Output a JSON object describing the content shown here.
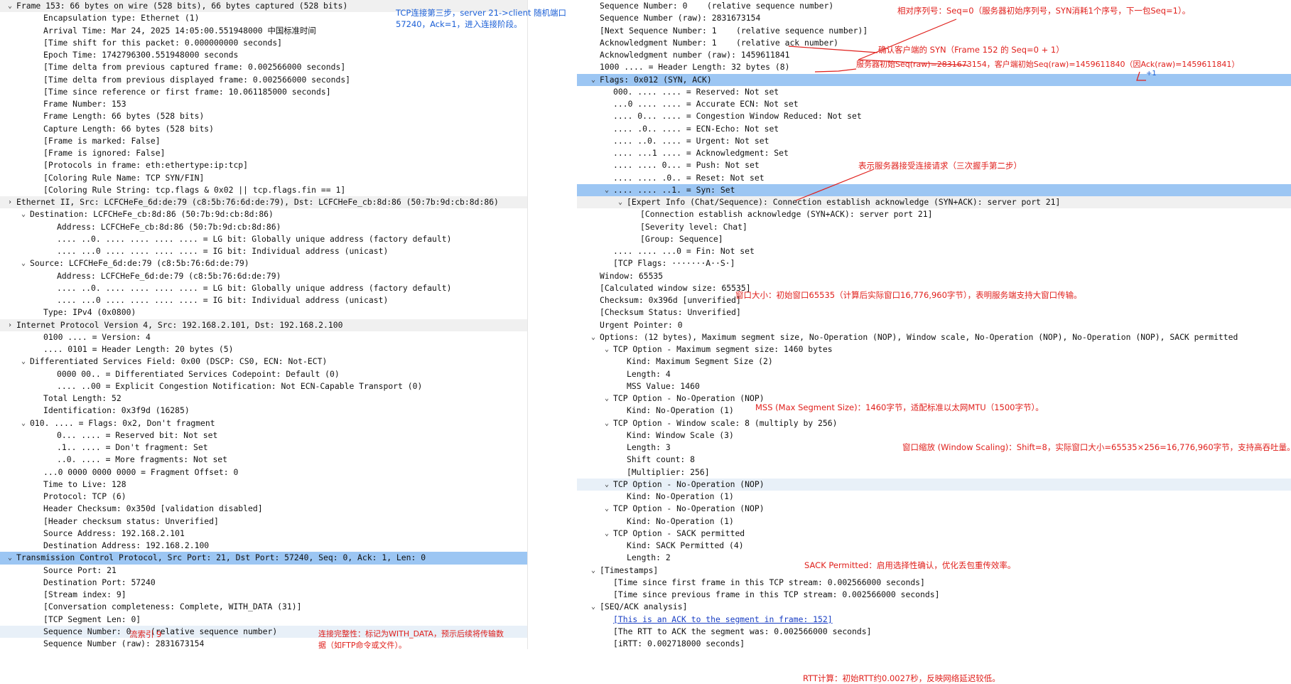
{
  "left": {
    "rows": [
      {
        "t": "Frame 153: 66 bytes on wire (528 bits), 66 bytes captured (528 bits)",
        "d": 0,
        "c": "open",
        "s": "hdr"
      },
      {
        "t": "Encapsulation type: Ethernet (1)",
        "d": 2
      },
      {
        "t": "Arrival Time: Mar 24, 2025 14:05:00.551948000 中国标准时间",
        "d": 2
      },
      {
        "t": "[Time shift for this packet: 0.000000000 seconds]",
        "d": 2
      },
      {
        "t": "Epoch Time: 1742796300.551948000 seconds",
        "d": 2
      },
      {
        "t": "[Time delta from previous captured frame: 0.002566000 seconds]",
        "d": 2
      },
      {
        "t": "[Time delta from previous displayed frame: 0.002566000 seconds]",
        "d": 2
      },
      {
        "t": "[Time since reference or first frame: 10.061185000 seconds]",
        "d": 2
      },
      {
        "t": "Frame Number: 153",
        "d": 2
      },
      {
        "t": "Frame Length: 66 bytes (528 bits)",
        "d": 2
      },
      {
        "t": "Capture Length: 66 bytes (528 bits)",
        "d": 2
      },
      {
        "t": "[Frame is marked: False]",
        "d": 2
      },
      {
        "t": "[Frame is ignored: False]",
        "d": 2
      },
      {
        "t": "[Protocols in frame: eth:ethertype:ip:tcp]",
        "d": 2
      },
      {
        "t": "[Coloring Rule Name: TCP SYN/FIN]",
        "d": 2
      },
      {
        "t": "[Coloring Rule String: tcp.flags & 0x02 || tcp.flags.fin == 1]",
        "d": 2
      },
      {
        "t": "Ethernet II, Src: LCFCHeFe_6d:de:79 (c8:5b:76:6d:de:79), Dst: LCFCHeFe_cb:8d:86 (50:7b:9d:cb:8d:86)",
        "d": 0,
        "c": "closed",
        "s": "hdr"
      },
      {
        "t": "Destination: LCFCHeFe_cb:8d:86 (50:7b:9d:cb:8d:86)",
        "d": 1,
        "c": "open"
      },
      {
        "t": "Address: LCFCHeFe_cb:8d:86 (50:7b:9d:cb:8d:86)",
        "d": 3
      },
      {
        "t": ".... ..0. .... .... .... .... = LG bit: Globally unique address (factory default)",
        "d": 3
      },
      {
        "t": ".... ...0 .... .... .... .... = IG bit: Individual address (unicast)",
        "d": 3
      },
      {
        "t": "Source: LCFCHeFe_6d:de:79 (c8:5b:76:6d:de:79)",
        "d": 1,
        "c": "open"
      },
      {
        "t": "Address: LCFCHeFe_6d:de:79 (c8:5b:76:6d:de:79)",
        "d": 3
      },
      {
        "t": ".... ..0. .... .... .... .... = LG bit: Globally unique address (factory default)",
        "d": 3
      },
      {
        "t": ".... ...0 .... .... .... .... = IG bit: Individual address (unicast)",
        "d": 3
      },
      {
        "t": "Type: IPv4 (0x0800)",
        "d": 2
      },
      {
        "t": "Internet Protocol Version 4, Src: 192.168.2.101, Dst: 192.168.2.100",
        "d": 0,
        "c": "closed",
        "s": "hdr"
      },
      {
        "t": "0100 .... = Version: 4",
        "d": 2
      },
      {
        "t": ".... 0101 = Header Length: 20 bytes (5)",
        "d": 2
      },
      {
        "t": "Differentiated Services Field: 0x00 (DSCP: CS0, ECN: Not-ECT)",
        "d": 1,
        "c": "open"
      },
      {
        "t": "0000 00.. = Differentiated Services Codepoint: Default (0)",
        "d": 3
      },
      {
        "t": ".... ..00 = Explicit Congestion Notification: Not ECN-Capable Transport (0)",
        "d": 3
      },
      {
        "t": "Total Length: 52",
        "d": 2
      },
      {
        "t": "Identification: 0x3f9d (16285)",
        "d": 2
      },
      {
        "t": "010. .... = Flags: 0x2, Don't fragment",
        "d": 1,
        "c": "open"
      },
      {
        "t": "0... .... = Reserved bit: Not set",
        "d": 3
      },
      {
        "t": ".1.. .... = Don't fragment: Set",
        "d": 3
      },
      {
        "t": "..0. .... = More fragments: Not set",
        "d": 3
      },
      {
        "t": "...0 0000 0000 0000 = Fragment Offset: 0",
        "d": 2
      },
      {
        "t": "Time to Live: 128",
        "d": 2
      },
      {
        "t": "Protocol: TCP (6)",
        "d": 2
      },
      {
        "t": "Header Checksum: 0x350d [validation disabled]",
        "d": 2
      },
      {
        "t": "[Header checksum status: Unverified]",
        "d": 2
      },
      {
        "t": "Source Address: 192.168.2.101",
        "d": 2
      },
      {
        "t": "Destination Address: 192.168.2.100",
        "d": 2
      },
      {
        "t": "Transmission Control Protocol, Src Port: 21, Dst Port: 57240, Seq: 0, Ack: 1, Len: 0",
        "d": 0,
        "c": "open",
        "s": "sel"
      },
      {
        "t": "Source Port: 21",
        "d": 2
      },
      {
        "t": "Destination Port: 57240",
        "d": 2
      },
      {
        "t": "[Stream index: 9]",
        "d": 2
      },
      {
        "t": "[Conversation completeness: Complete, WITH_DATA (31)]",
        "d": 2
      },
      {
        "t": "[TCP Segment Len: 0]",
        "d": 2
      },
      {
        "t": "Sequence Number: 0    (relative sequence number)",
        "d": 2,
        "s": "hov"
      },
      {
        "t": "Sequence Number (raw): 2831673154",
        "d": 2
      }
    ]
  },
  "right": {
    "rows": [
      {
        "t": "Sequence Number: 0    (relative sequence number)",
        "d": 0
      },
      {
        "t": "Sequence Number (raw): 2831673154",
        "d": 0
      },
      {
        "t": "[Next Sequence Number: 1    (relative sequence number)]",
        "d": 0
      },
      {
        "t": "Acknowledgment Number: 1    (relative ack number)",
        "d": 0
      },
      {
        "t": "Acknowledgment number (raw): 1459611841",
        "d": 0
      },
      {
        "t": "1000 .... = Header Length: 32 bytes (8)",
        "d": 0
      },
      {
        "t": "Flags: 0x012 (SYN, ACK)",
        "d": 0,
        "c": "open",
        "s": "sel"
      },
      {
        "t": "000. .... .... = Reserved: Not set",
        "d": 1
      },
      {
        "t": "...0 .... .... = Accurate ECN: Not set",
        "d": 1
      },
      {
        "t": ".... 0... .... = Congestion Window Reduced: Not set",
        "d": 1
      },
      {
        "t": ".... .0.. .... = ECN-Echo: Not set",
        "d": 1
      },
      {
        "t": ".... ..0. .... = Urgent: Not set",
        "d": 1
      },
      {
        "t": ".... ...1 .... = Acknowledgment: Set",
        "d": 1
      },
      {
        "t": ".... .... 0... = Push: Not set",
        "d": 1
      },
      {
        "t": ".... .... .0.. = Reset: Not set",
        "d": 1
      },
      {
        "t": ".... .... ..1. = Syn: Set",
        "d": 1,
        "c": "open",
        "s": "sel"
      },
      {
        "t": "[Expert Info (Chat/Sequence): Connection establish acknowledge (SYN+ACK): server port 21]",
        "d": 2,
        "c": "open",
        "s": "hdr"
      },
      {
        "t": "[Connection establish acknowledge (SYN+ACK): server port 21]",
        "d": 3
      },
      {
        "t": "[Severity level: Chat]",
        "d": 3
      },
      {
        "t": "[Group: Sequence]",
        "d": 3
      },
      {
        "t": ".... .... ...0 = Fin: Not set",
        "d": 1
      },
      {
        "t": "[TCP Flags: ·······A··S·]",
        "d": 1
      },
      {
        "t": "Window: 65535",
        "d": 0
      },
      {
        "t": "[Calculated window size: 65535]",
        "d": 0
      },
      {
        "t": "Checksum: 0x396d [unverified]",
        "d": 0
      },
      {
        "t": "[Checksum Status: Unverified]",
        "d": 0
      },
      {
        "t": "Urgent Pointer: 0",
        "d": 0
      },
      {
        "t": "Options: (12 bytes), Maximum segment size, No-Operation (NOP), Window scale, No-Operation (NOP), No-Operation (NOP), SACK permitted",
        "d": 0,
        "c": "open"
      },
      {
        "t": "TCP Option - Maximum segment size: 1460 bytes",
        "d": 1,
        "c": "open"
      },
      {
        "t": "Kind: Maximum Segment Size (2)",
        "d": 2
      },
      {
        "t": "Length: 4",
        "d": 2
      },
      {
        "t": "MSS Value: 1460",
        "d": 2
      },
      {
        "t": "TCP Option - No-Operation (NOP)",
        "d": 1,
        "c": "open"
      },
      {
        "t": "Kind: No-Operation (1)",
        "d": 2
      },
      {
        "t": "TCP Option - Window scale: 8 (multiply by 256)",
        "d": 1,
        "c": "open"
      },
      {
        "t": "Kind: Window Scale (3)",
        "d": 2
      },
      {
        "t": "Length: 3",
        "d": 2
      },
      {
        "t": "Shift count: 8",
        "d": 2
      },
      {
        "t": "[Multiplier: 256]",
        "d": 2
      },
      {
        "t": "TCP Option - No-Operation (NOP)",
        "d": 1,
        "c": "open",
        "s": "hov"
      },
      {
        "t": "Kind: No-Operation (1)",
        "d": 2
      },
      {
        "t": "TCP Option - No-Operation (NOP)",
        "d": 1,
        "c": "open"
      },
      {
        "t": "Kind: No-Operation (1)",
        "d": 2
      },
      {
        "t": "TCP Option - SACK permitted",
        "d": 1,
        "c": "open"
      },
      {
        "t": "Kind: SACK Permitted (4)",
        "d": 2
      },
      {
        "t": "Length: 2",
        "d": 2
      },
      {
        "t": "[Timestamps]",
        "d": 0,
        "c": "open"
      },
      {
        "t": "[Time since first frame in this TCP stream: 0.002566000 seconds]",
        "d": 1
      },
      {
        "t": "[Time since previous frame in this TCP stream: 0.002566000 seconds]",
        "d": 1
      },
      {
        "t": "[SEQ/ACK analysis]",
        "d": 0,
        "c": "open"
      },
      {
        "t": "[This is an ACK to the segment in frame: 152]",
        "d": 1,
        "link": true
      },
      {
        "t": "[The RTT to ACK the segment was: 0.002566000 seconds]",
        "d": 1
      },
      {
        "t": "[iRTT: 0.002718000 seconds]",
        "d": 1
      }
    ]
  },
  "annotations": {
    "step3": "TCP连接第三步，server 21->client 随机端口\n57240，Ack=1，进入连接阶段。",
    "stream": "流索引 9",
    "completeness": "连接完整性：标记为WITH_DATA，预示后续将传输数\n据（如FTP命令或文件）。",
    "rel_seq": "相对序列号：Seq=0（服务器初始序列号，SYN消耗1个序号，下一包Seq=1）。",
    "ack_confirm": "确认客户端的 SYN（Frame 152 的 Seq=0 + 1）",
    "raw_seq": "服务器初始Seq(raw)=2831673154，客户端初始Seq(raw)=1459611840（因Ack(raw)=1459611841）",
    "plus_one": "+1",
    "syn_ack": "表示服务器接受连接请求（三次握手第二步）",
    "window": "窗口大小：初始窗口65535（计算后实际窗口16,776,960字节），表明服务端支持大窗口传输。",
    "mss": "MSS (Max Segment Size)：1460字节，适配标准以太网MTU（1500字节）。",
    "wscale": "窗口缩放 (Window Scaling)：Shift=8，实际窗口大小=65535×256=16,776,960字节，支持高吞吐量。",
    "sack": "SACK Permitted：启用选择性确认，优化丢包重传效率。",
    "rtt": "RTT计算：初始RTT约0.0027秒，反映网络延迟较低。"
  },
  "colors": {
    "selected_row": "#9cc6f3",
    "annotation_red": "#e0201c",
    "annotation_blue": "#1b5fd6",
    "link": "#1a3fc4"
  }
}
